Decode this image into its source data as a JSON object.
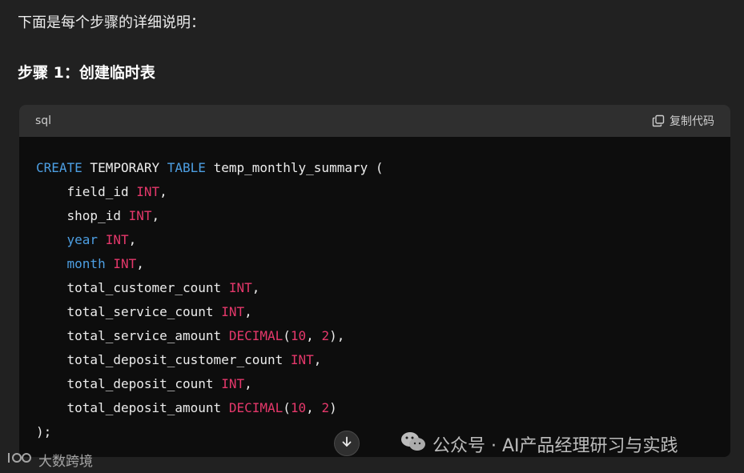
{
  "intro_text": "下面是每个步骤的详细说明：",
  "step_title": "步骤 1：创建临时表",
  "code_block": {
    "language": "sql",
    "copy_label": "复制代码",
    "lines": [
      [
        [
          "kw",
          "CREATE"
        ],
        [
          "p",
          " TEMPORARY "
        ],
        [
          "kw",
          "TABLE"
        ],
        [
          "p",
          " temp_monthly_summary ("
        ]
      ],
      [
        [
          "p",
          "    field_id "
        ],
        [
          "ty",
          "INT"
        ],
        [
          "p",
          ","
        ]
      ],
      [
        [
          "p",
          "    shop_id "
        ],
        [
          "ty",
          "INT"
        ],
        [
          "p",
          ","
        ]
      ],
      [
        [
          "p",
          "    "
        ],
        [
          "kw",
          "year"
        ],
        [
          "p",
          " "
        ],
        [
          "ty",
          "INT"
        ],
        [
          "p",
          ","
        ]
      ],
      [
        [
          "p",
          "    "
        ],
        [
          "kw",
          "month"
        ],
        [
          "p",
          " "
        ],
        [
          "ty",
          "INT"
        ],
        [
          "p",
          ","
        ]
      ],
      [
        [
          "p",
          "    total_customer_count "
        ],
        [
          "ty",
          "INT"
        ],
        [
          "p",
          ","
        ]
      ],
      [
        [
          "p",
          "    total_service_count "
        ],
        [
          "ty",
          "INT"
        ],
        [
          "p",
          ","
        ]
      ],
      [
        [
          "p",
          "    total_service_amount "
        ],
        [
          "ty",
          "DECIMAL"
        ],
        [
          "p",
          "("
        ],
        [
          "num",
          "10"
        ],
        [
          "p",
          ", "
        ],
        [
          "num",
          "2"
        ],
        [
          "p",
          "),"
        ]
      ],
      [
        [
          "p",
          "    total_deposit_customer_count "
        ],
        [
          "ty",
          "INT"
        ],
        [
          "p",
          ","
        ]
      ],
      [
        [
          "p",
          "    total_deposit_count "
        ],
        [
          "ty",
          "INT"
        ],
        [
          "p",
          ","
        ]
      ],
      [
        [
          "p",
          "    total_deposit_amount "
        ],
        [
          "ty",
          "DECIMAL"
        ],
        [
          "p",
          "("
        ],
        [
          "num",
          "10"
        ],
        [
          "p",
          ", "
        ],
        [
          "num",
          "2"
        ],
        [
          "p",
          ")"
        ]
      ],
      [
        [
          "p",
          ");"
        ]
      ]
    ]
  },
  "watermark_wechat": "公众号 · AI产品经理研习与实践",
  "watermark_logo": "大数跨境",
  "colors": {
    "keyword": "#4d9fe3",
    "type": "#e5386b",
    "background": "#212121",
    "code_bg": "#0d0d0d",
    "header_bg": "#2f2f2f"
  }
}
